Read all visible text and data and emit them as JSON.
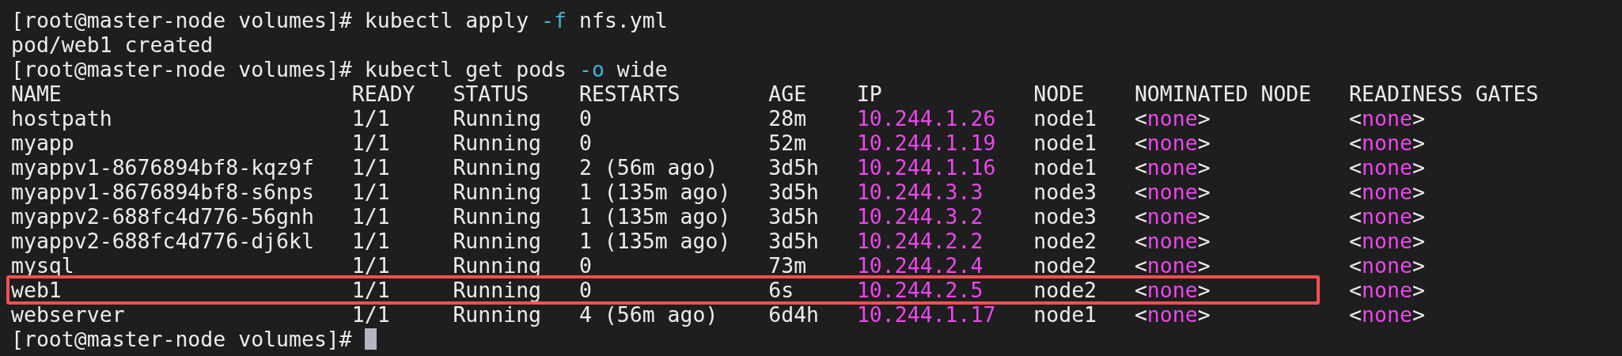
{
  "lines_before": [
    {
      "segments": [
        {
          "text": "[root@master-node volumes]# kubectl apply ",
          "kind": "plain"
        },
        {
          "text": "-f",
          "kind": "flag"
        },
        {
          "text": " nfs.yml",
          "kind": "plain"
        }
      ]
    },
    {
      "segments": [
        {
          "text": "pod/web1 created",
          "kind": "plain"
        }
      ]
    },
    {
      "segments": [
        {
          "text": "[root@master-node volumes]# kubectl get pods ",
          "kind": "plain"
        },
        {
          "text": "-o",
          "kind": "flag"
        },
        {
          "text": " wide",
          "kind": "plain"
        }
      ]
    }
  ],
  "table": {
    "columns": [
      {
        "label": "NAME",
        "kind": "text"
      },
      {
        "label": "READY",
        "kind": "text"
      },
      {
        "label": "STATUS",
        "kind": "text"
      },
      {
        "label": "RESTARTS",
        "kind": "text"
      },
      {
        "label": "AGE",
        "kind": "text"
      },
      {
        "label": "IP",
        "kind": "ip"
      },
      {
        "label": "NODE",
        "kind": "text"
      },
      {
        "label": "NOMINATED NODE",
        "kind": "tag"
      },
      {
        "label": "READINESS GATES",
        "kind": "tag"
      }
    ],
    "rows": [
      {
        "highlighted": false,
        "cells": [
          "hostpath",
          "1/1",
          "Running",
          "0",
          "28m",
          "10.244.1.26",
          "node1",
          {
            "open": "<",
            "value": "none",
            "close": ">"
          },
          {
            "open": "<",
            "value": "none",
            "close": ">"
          }
        ]
      },
      {
        "highlighted": false,
        "cells": [
          "myapp",
          "1/1",
          "Running",
          "0",
          "52m",
          "10.244.1.19",
          "node1",
          {
            "open": "<",
            "value": "none",
            "close": ">"
          },
          {
            "open": "<",
            "value": "none",
            "close": ">"
          }
        ]
      },
      {
        "highlighted": false,
        "cells": [
          "myappv1-8676894bf8-kqz9f",
          "1/1",
          "Running",
          "2 (56m ago)",
          "3d5h",
          "10.244.1.16",
          "node1",
          {
            "open": "<",
            "value": "none",
            "close": ">"
          },
          {
            "open": "<",
            "value": "none",
            "close": ">"
          }
        ]
      },
      {
        "highlighted": false,
        "cells": [
          "myappv1-8676894bf8-s6nps",
          "1/1",
          "Running",
          "1 (135m ago)",
          "3d5h",
          "10.244.3.3",
          "node3",
          {
            "open": "<",
            "value": "none",
            "close": ">"
          },
          {
            "open": "<",
            "value": "none",
            "close": ">"
          }
        ]
      },
      {
        "highlighted": false,
        "cells": [
          "myappv2-688fc4d776-56gnh",
          "1/1",
          "Running",
          "1 (135m ago)",
          "3d5h",
          "10.244.3.2",
          "node3",
          {
            "open": "<",
            "value": "none",
            "close": ">"
          },
          {
            "open": "<",
            "value": "none",
            "close": ">"
          }
        ]
      },
      {
        "highlighted": false,
        "cells": [
          "myappv2-688fc4d776-dj6kl",
          "1/1",
          "Running",
          "1 (135m ago)",
          "3d5h",
          "10.244.2.2",
          "node2",
          {
            "open": "<",
            "value": "none",
            "close": ">"
          },
          {
            "open": "<",
            "value": "none",
            "close": ">"
          }
        ]
      },
      {
        "highlighted": false,
        "cells": [
          "mysql",
          "1/1",
          "Running",
          "0",
          "73m",
          "10.244.2.4",
          "node2",
          {
            "open": "<",
            "value": "none",
            "close": ">"
          },
          {
            "open": "<",
            "value": "none",
            "close": ">"
          }
        ]
      },
      {
        "highlighted": true,
        "cells": [
          "web1",
          "1/1",
          "Running",
          "0",
          "6s",
          "10.244.2.5",
          "node2",
          {
            "open": "<",
            "value": "none",
            "close": ">"
          },
          {
            "open": "<",
            "value": "none",
            "close": ">"
          }
        ]
      },
      {
        "highlighted": false,
        "cells": [
          "webserver",
          "1/1",
          "Running",
          "4 (56m ago)",
          "6d4h",
          "10.244.1.17",
          "node1",
          {
            "open": "<",
            "value": "none",
            "close": ">"
          },
          {
            "open": "<",
            "value": "none",
            "close": ">"
          }
        ]
      }
    ]
  },
  "prompt": {
    "text": "[root@master-node volumes]# ",
    "cursor": true
  }
}
